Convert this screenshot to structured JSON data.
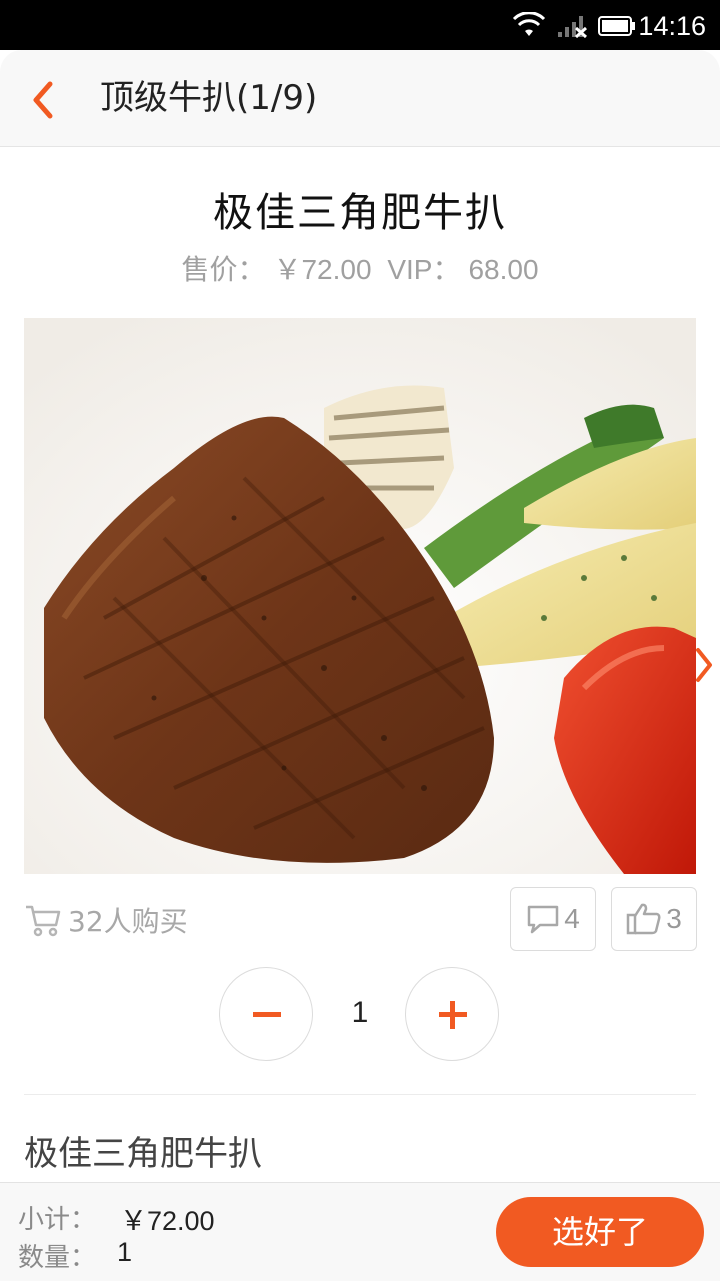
{
  "status_bar": {
    "time": "14:16"
  },
  "header": {
    "title": "顶级牛扒(1/9)"
  },
  "product": {
    "name": "极佳三角肥牛扒",
    "price_label": "售价：",
    "price": "￥72.00",
    "vip_label": "VIP：",
    "vip_price": "68.00"
  },
  "stats": {
    "buyers": "32人购买",
    "comments": "4",
    "likes": "3"
  },
  "quantity": {
    "value": "1"
  },
  "description": {
    "title": "极佳三角肥牛扒"
  },
  "footer": {
    "subtotal_label": "小计：",
    "subtotal": "￥72.00",
    "qty_label": "数量：",
    "qty": "1",
    "confirm_label": "选好了"
  },
  "colors": {
    "accent": "#f15a22"
  }
}
